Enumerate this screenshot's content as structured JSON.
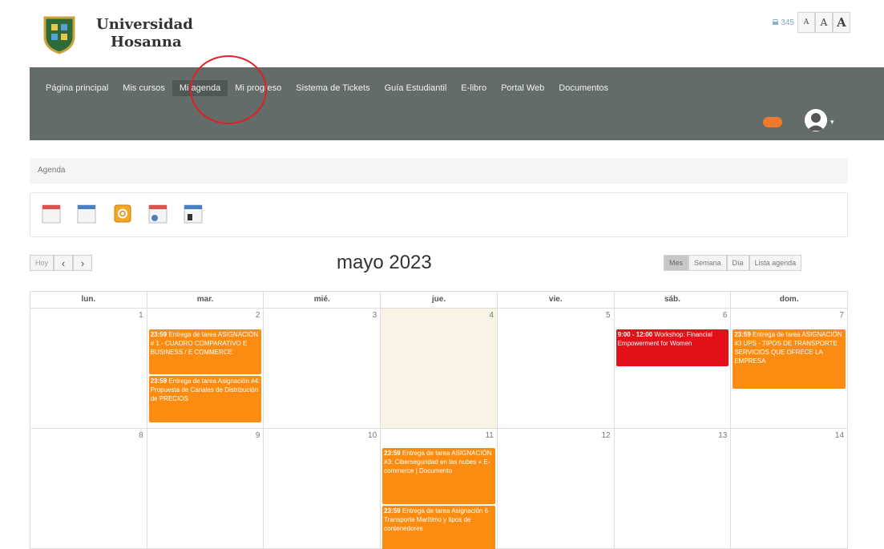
{
  "header": {
    "brand_line1": "Universidad",
    "brand_line2": "Hosanna",
    "counter": "345",
    "font_small": "A",
    "font_medium": "A",
    "font_large": "A"
  },
  "nav": {
    "items": [
      "Página principal",
      "Mis cursos",
      "Mi agenda",
      "Mi progreso",
      "Sistema de Tickets",
      "Guía Estudiantil",
      "E-libro",
      "Portal Web",
      "Documentos"
    ],
    "active_index": 2
  },
  "breadcrumb": "Agenda",
  "toolbar_icons": [
    "calendar-add-icon",
    "calendar-blue-icon",
    "ical-export-icon",
    "calendar-personal-icon",
    "calendar-session-icon"
  ],
  "calendar": {
    "title": "mayo 2023",
    "today_button": "Hoy",
    "prev": "‹",
    "next": "›",
    "views": [
      "Mes",
      "Semana",
      "Día",
      "Lista agenda"
    ],
    "active_view": "Mes",
    "weekdays": [
      "lun.",
      "mar.",
      "mié.",
      "jue.",
      "vie.",
      "sáb.",
      "dom."
    ],
    "weeks": [
      [
        "1",
        "2",
        "3",
        "4",
        "5",
        "6",
        "7"
      ],
      [
        "8",
        "9",
        "10",
        "11",
        "12",
        "13",
        "14"
      ]
    ],
    "today": "4",
    "events": {
      "e1_time": "23:59",
      "e1_text": "Entrega de tarea ASIGNACIÓN # 1 - CUADRO COMPARATIVO E BUSINESS / E COMMERCE",
      "e2_time": "23:59",
      "e2_text": "Entrega de tarea Asignación #4: Propuesta de Canales de Distribución de PRECIOS",
      "e3_time": "9:00 - 12:00",
      "e3_text": "Workshop: Financial Empowerment for Women",
      "e4_time": "23:59",
      "e4_text": "Entrega de tarea ASIGNACIÓN #3 UPS - TIPOS DE TRANSPORTE SERVICIOS QUE OFRECE LA EMPRESA",
      "e5_time": "23:59",
      "e5_text": "Entrega de tarea ASIGNACIÓN #3: Ciberseguridad en las nubes + E-commerce | Documento",
      "e6_time": "23:59",
      "e6_text": "Entrega de tarea Asignación 6 Transporte Marítimo y tipos de contenedores"
    }
  },
  "colors": {
    "nav_bg": "#636c68",
    "event_orange": "#fb8c11",
    "event_red": "#e3101a",
    "today_bg": "#f8f3e2",
    "annotation_ring": "#e31e24"
  }
}
